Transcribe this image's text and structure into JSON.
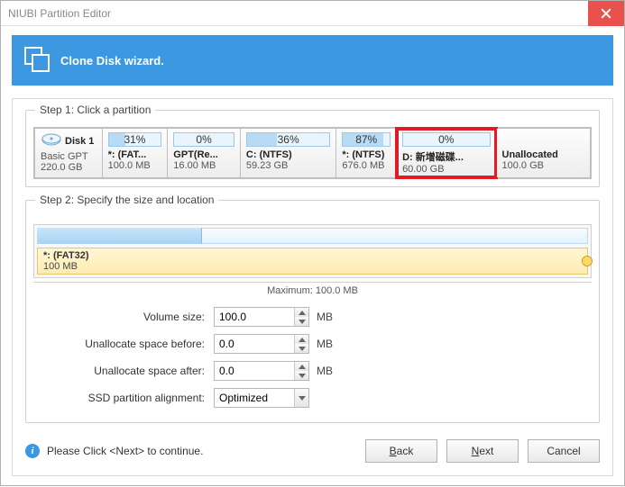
{
  "title": "NIUBI Partition Editor",
  "banner_text": "Clone Disk wizard.",
  "step1_label": "Step 1: Click a partition",
  "disk": {
    "name": "Disk 1",
    "type": "Basic GPT",
    "size": "220.0 GB"
  },
  "partitions": [
    {
      "usage": "31%",
      "fill": 31,
      "name": "*: (FAT...",
      "size": "100.0 MB"
    },
    {
      "usage": "0%",
      "fill": 0,
      "name": "GPT(Re...",
      "size": "16.00 MB"
    },
    {
      "usage": "36%",
      "fill": 36,
      "name": "C: (NTFS)",
      "size": "59.23 GB"
    },
    {
      "usage": "87%",
      "fill": 87,
      "name": "*: (NTFS)",
      "size": "676.0 MB"
    },
    {
      "usage": "0%",
      "fill": 0,
      "name": "D: 新增磁碟...",
      "size": "60.00 GB"
    },
    {
      "usage": "",
      "fill": 0,
      "name": "Unallocated",
      "size": "100.0 GB"
    }
  ],
  "step2_label": "Step 2: Specify the size and location",
  "legend": {
    "name": "*: (FAT32)",
    "size": "100 MB"
  },
  "max_text": "Maximum: 100.0 MB",
  "form": {
    "volume_label": "Volume size:",
    "volume_value": "100.0",
    "volume_unit": "MB",
    "before_label": "Unallocate space before:",
    "before_value": "0.0",
    "before_unit": "MB",
    "after_label": "Unallocate space after:",
    "after_value": "0.0",
    "after_unit": "MB",
    "ssd_label": "SSD partition alignment:",
    "ssd_value": "Optimized"
  },
  "footer_text": "Please Click <Next> to continue.",
  "buttons": {
    "back": "Back",
    "next": "Next",
    "cancel": "Cancel"
  }
}
